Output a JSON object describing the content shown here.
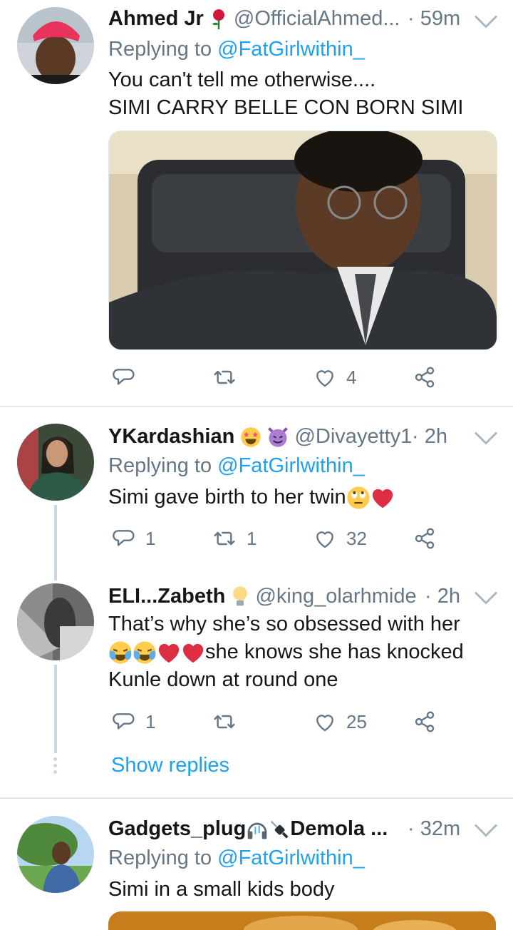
{
  "tweets": [
    {
      "name": "Ahmed Jr",
      "handle": "@OfficialAhmed...",
      "time": "· 59m",
      "replying_prefix": "Replying to ",
      "replying_to": "@FatGirlwithin_",
      "text_lines": [
        "You can't tell me otherwise....",
        "SIMI CARRY BELLE CON BORN SIMI"
      ],
      "actions": {
        "replies": "",
        "retweets": "",
        "likes": "4"
      }
    },
    {
      "name": "YKardashian",
      "handle": "@Divayetty1",
      "time": "· 2h",
      "replying_prefix": "Replying to ",
      "replying_to": "@FatGirlwithin_",
      "text_lines": [
        "Simi gave birth to her twin"
      ],
      "actions": {
        "replies": "1",
        "retweets": "1",
        "likes": "32"
      }
    },
    {
      "name": "ELI...Zabeth",
      "handle": "@king_olarhmide",
      "time": "· 2h",
      "text_lines": [
        "That’s why she’s so obsessed with her",
        "she knows she has knocked",
        "Kunle down at round one"
      ],
      "actions": {
        "replies": "1",
        "retweets": "",
        "likes": "25"
      },
      "show_replies": "Show replies"
    },
    {
      "name_part1": "Gadgets_plug",
      "name_part2": "Demola ...",
      "time": "· 32m",
      "replying_prefix": "Replying to ",
      "replying_to": "@FatGirlwithin_",
      "text_lines": [
        "Simi in a small kids body"
      ]
    }
  ],
  "colors": {
    "link": "#1da1f2",
    "muted": "#657786",
    "text": "#14171a",
    "heart": "#e0245e",
    "divider": "#e1e8ed"
  },
  "icons": [
    "reply-icon",
    "retweet-icon",
    "like-icon",
    "share-icon",
    "chevron-down-icon",
    "rose-icon",
    "star-struck-icon",
    "devil-icon",
    "eye-roll-icon",
    "red-heart-icon",
    "bulb-icon",
    "crying-laughing-icon",
    "headphones-icon",
    "plug-icon"
  ]
}
